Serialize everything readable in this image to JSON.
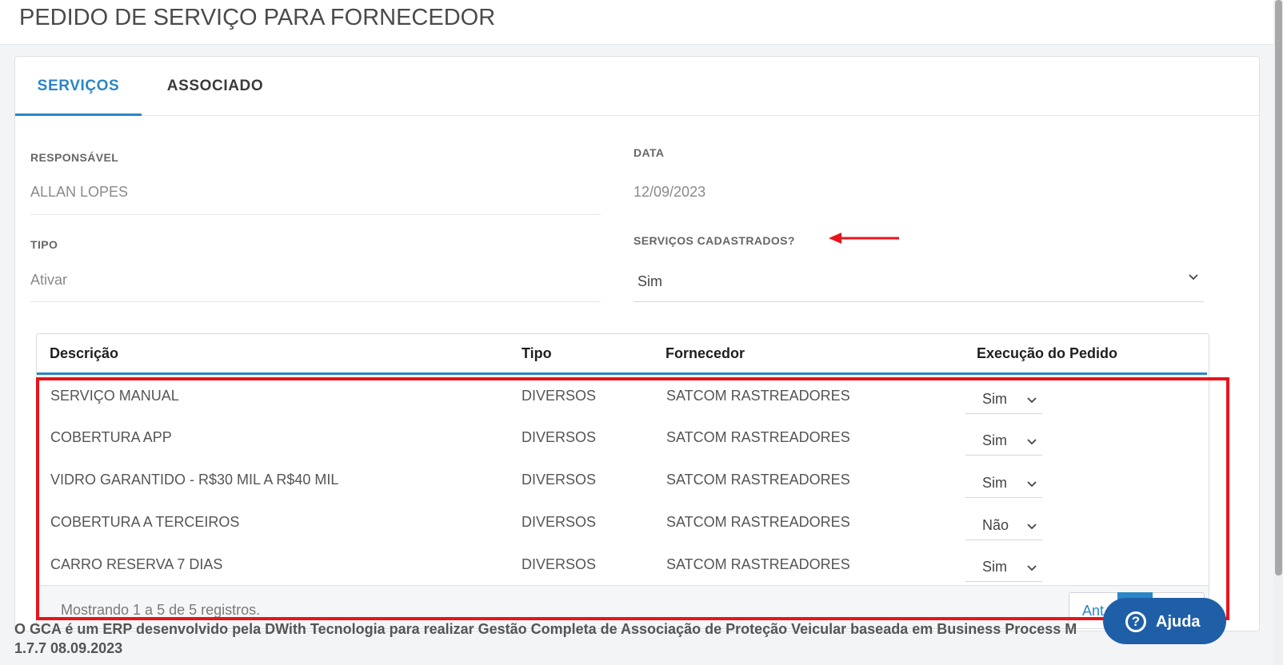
{
  "page": {
    "title": "PEDIDO DE SERVIÇO PARA FORNECEDOR"
  },
  "tabs": [
    {
      "label": "SERVIÇOS",
      "active": true
    },
    {
      "label": "ASSOCIADO",
      "active": false
    }
  ],
  "form": {
    "responsavel": {
      "label": "RESPONSÁVEL",
      "value": "ALLAN LOPES"
    },
    "data": {
      "label": "DATA",
      "value": "12/09/2023"
    },
    "tipo": {
      "label": "TIPO",
      "value": "Ativar"
    },
    "servicos_cadastrados": {
      "label": "SERVIÇOS CADASTRADOS?",
      "value": "Sim"
    }
  },
  "table": {
    "columns": [
      "Descrição",
      "Tipo",
      "Fornecedor",
      "Execução do Pedido"
    ],
    "rows": [
      {
        "descricao": "SERVIÇO MANUAL",
        "tipo": "DIVERSOS",
        "fornecedor": "SATCOM RASTREADORES",
        "execucao": "Sim"
      },
      {
        "descricao": "COBERTURA APP",
        "tipo": "DIVERSOS",
        "fornecedor": "SATCOM RASTREADORES",
        "execucao": "Sim"
      },
      {
        "descricao": "VIDRO GARANTIDO - R$30 MIL A R$40 MIL",
        "tipo": "DIVERSOS",
        "fornecedor": "SATCOM RASTREADORES",
        "execucao": "Sim"
      },
      {
        "descricao": "COBERTURA A TERCEIROS",
        "tipo": "DIVERSOS",
        "fornecedor": "SATCOM RASTREADORES",
        "execucao": "Não"
      },
      {
        "descricao": "CARRO RESERVA 7 DIAS",
        "tipo": "DIVERSOS",
        "fornecedor": "SATCOM RASTREADORES",
        "execucao": "Sim"
      }
    ],
    "info": "Mostrando 1 a 5 de 5 registros.",
    "pager_prev": "Ant"
  },
  "footer": {
    "text": "O GCA é um ERP desenvolvido pela DWith Tecnologia para realizar Gestão Completa de Associação de Proteção Veicular baseada em Business Process M",
    "text_tail": ")",
    "version": "1.7.7 08.09.2023"
  },
  "help": {
    "label": "Ajuda",
    "icon": "question-circle-icon"
  },
  "colors": {
    "accent": "#2a86c6",
    "annotation": "#e8141c",
    "help": "#1f5fa8"
  }
}
